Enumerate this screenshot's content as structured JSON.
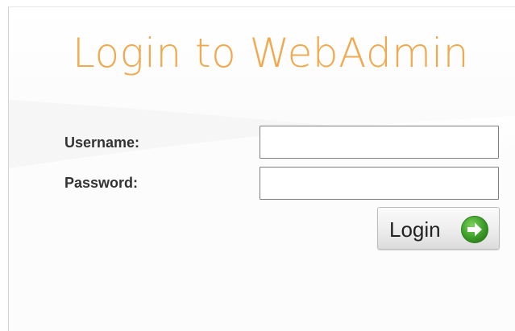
{
  "title": "Login to WebAdmin",
  "form": {
    "username_label": "Username:",
    "username_value": "",
    "password_label": "Password:",
    "password_value": "",
    "login_label": "Login",
    "login_icon": "arrow-right-circle-icon"
  },
  "colors": {
    "title": "#f0a94e",
    "icon_green": "#3fa22a"
  }
}
